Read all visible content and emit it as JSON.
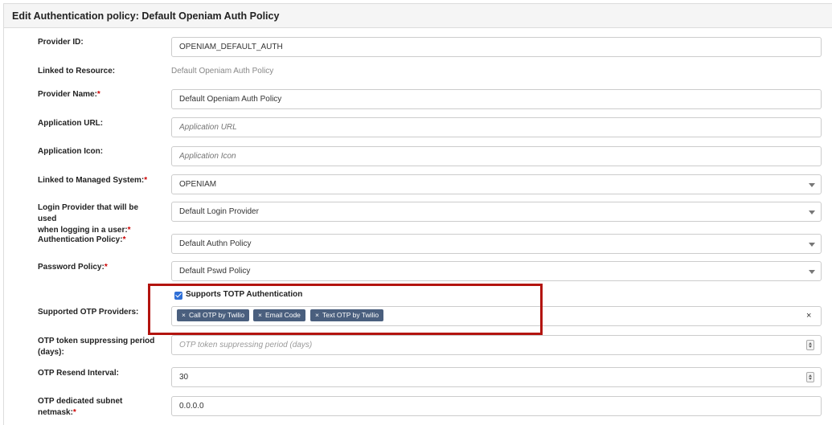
{
  "header": {
    "title": "Edit Authentication policy: Default Openiam Auth Policy"
  },
  "form": {
    "provider_id": {
      "label": "Provider ID:",
      "value": "OPENIAM_DEFAULT_AUTH"
    },
    "linked_resource": {
      "label": "Linked to Resource:",
      "value": "Default Openiam Auth Policy"
    },
    "provider_name": {
      "label": "Provider Name:",
      "required": "*",
      "value": "Default Openiam Auth Policy"
    },
    "application_url": {
      "label": "Application URL:",
      "placeholder": "Application URL"
    },
    "application_icon": {
      "label": "Application Icon:",
      "placeholder": "Application Icon"
    },
    "managed_system": {
      "label": "Linked to Managed System:",
      "required": "*",
      "value": "OPENIAM"
    },
    "login_provider": {
      "label_line1": "Login Provider that will be used",
      "label_line2": "when logging in a user:",
      "required": "*",
      "value": "Default Login Provider"
    },
    "authentication_policy": {
      "label": "Authentication Policy:",
      "required": "*",
      "value": "Default Authn Policy"
    },
    "password_policy": {
      "label": "Password Policy:",
      "required": "*",
      "value": "Default Pswd Policy"
    },
    "totp": {
      "label": "Supports TOTP Authentication",
      "checked": true
    },
    "otp_providers": {
      "label": "Supported OTP Providers:",
      "tags": [
        "Call OTP by Twilio",
        "Email Code",
        "Text OTP by Twilio"
      ],
      "remove_symbol": "×",
      "clear_symbol": "×"
    },
    "otp_suppress": {
      "label_line1": "OTP token suppressing period",
      "label_line2": "(days):",
      "placeholder": "OTP token suppressing period (days)"
    },
    "otp_resend": {
      "label": "OTP Resend Interval:",
      "value": "30"
    },
    "otp_subnet": {
      "label_line1": "OTP dedicated subnet",
      "label_line2": "netmask:",
      "required": "*",
      "value": "0.0.0.0"
    }
  },
  "colors": {
    "highlight": "#b3140f",
    "tag_bg": "#4a5f7e",
    "checkbox": "#2f6fd6",
    "required": "#cc0000"
  }
}
